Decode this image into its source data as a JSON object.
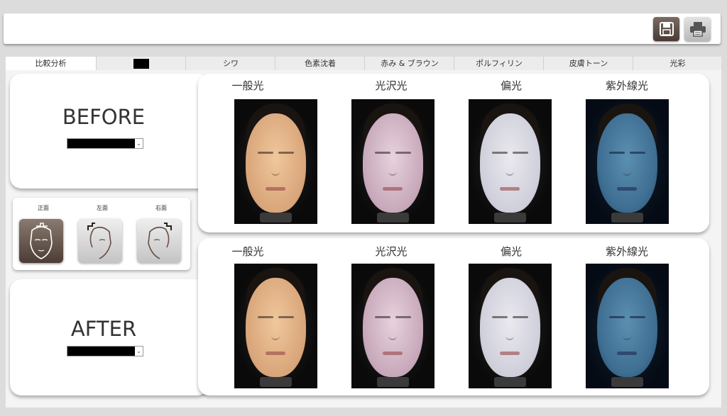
{
  "tabs": [
    {
      "label": "比較分析",
      "active": true
    },
    {
      "label": "",
      "redacted": true
    },
    {
      "label": "シワ"
    },
    {
      "label": "色素沈着"
    },
    {
      "label": "赤み & ブラウン"
    },
    {
      "label": "ポルフィリン"
    },
    {
      "label": "皮膚トーン"
    },
    {
      "label": "光彩"
    }
  ],
  "toolbar": {
    "save_icon": "floppy-disk-icon",
    "print_icon": "printer-icon"
  },
  "before": {
    "label": "BEFORE",
    "select_value": "",
    "columns": [
      "一般光",
      "光沢光",
      "偏光",
      "紫外線光"
    ]
  },
  "after": {
    "label": "AFTER",
    "select_value": "",
    "columns": [
      "一般光",
      "光沢光",
      "偏光",
      "紫外線光"
    ]
  },
  "views": {
    "front": "正面",
    "left": "左面",
    "right": "右面",
    "selected": "front"
  },
  "colors": {
    "accent_brown": "#5a4a42",
    "background": "#dcdcdc",
    "panel": "#ffffff"
  }
}
